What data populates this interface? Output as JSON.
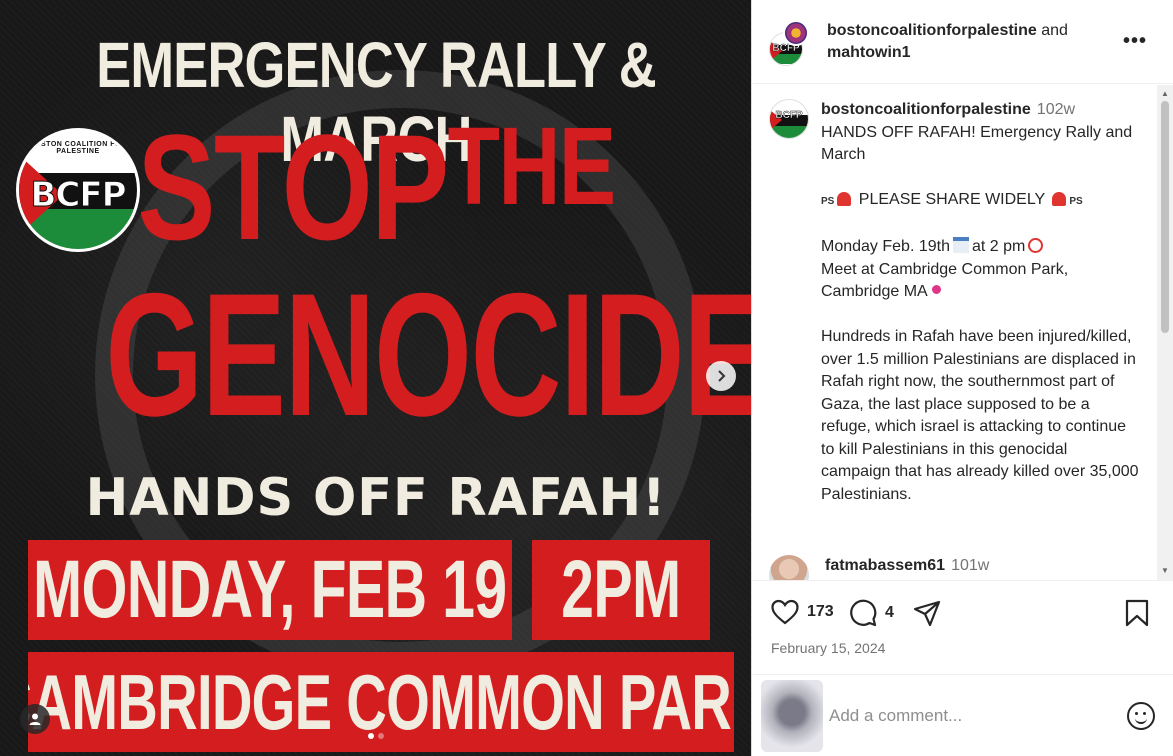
{
  "poster": {
    "headline_top": "EMERGENCY RALLY & MARCH",
    "stop": "STOP",
    "the": "THE",
    "genocide": "GENOCIDE",
    "hands_off": "HANDS OFF RAFAH!",
    "date": "MONDAY, FEB 19",
    "time": "2PM",
    "place": "CAMBRIDGE COMMON PARK",
    "logo_ring_text": "BOSTON COALITION FOR PALESTINE",
    "logo_mono": "BCFP"
  },
  "header": {
    "user1": "bostoncoalitionforpalestine",
    "and": " and",
    "user2": "mahtowin1",
    "more": "•••"
  },
  "caption": {
    "user": "bostoncoalitionforpalestine",
    "time": "102w",
    "line1": "HANDS OFF RAFAH! Emergency Rally and March",
    "ps": "PS",
    "share": "PLEASE SHARE WIDELY",
    "when_a": "Monday Feb. 19th",
    "when_b": "at 2 pm",
    "where_a": "Meet at Cambridge Common Park,",
    "where_b": "Cambridge MA",
    "body": "Hundreds in Rafah have been injured/killed, over 1.5 million Palestinians are displaced in Rafah right now, the southernmost part of Gaza, the last place supposed to be a refuge, which israel is attacking to continue to kill Palestinians in this genocidal campaign that has already killed over 35,000 Palestinians."
  },
  "comment": {
    "user": "fatmabassem61",
    "time": "101w"
  },
  "actions": {
    "likes": "173",
    "comments": "4"
  },
  "post_date": "February 15, 2024",
  "add_comment": {
    "placeholder": "Add a comment..."
  },
  "colors": {
    "poster_red": "#d41d1f",
    "poster_cream": "#f1ece0",
    "flag_green": "#1c8b3a"
  },
  "icons": {
    "next": "chevron-right-icon",
    "like": "heart-icon",
    "comment": "comment-bubble-icon",
    "share": "paper-plane-icon",
    "save": "bookmark-icon",
    "emoji": "smiley-icon",
    "tag": "person-tag-icon"
  }
}
